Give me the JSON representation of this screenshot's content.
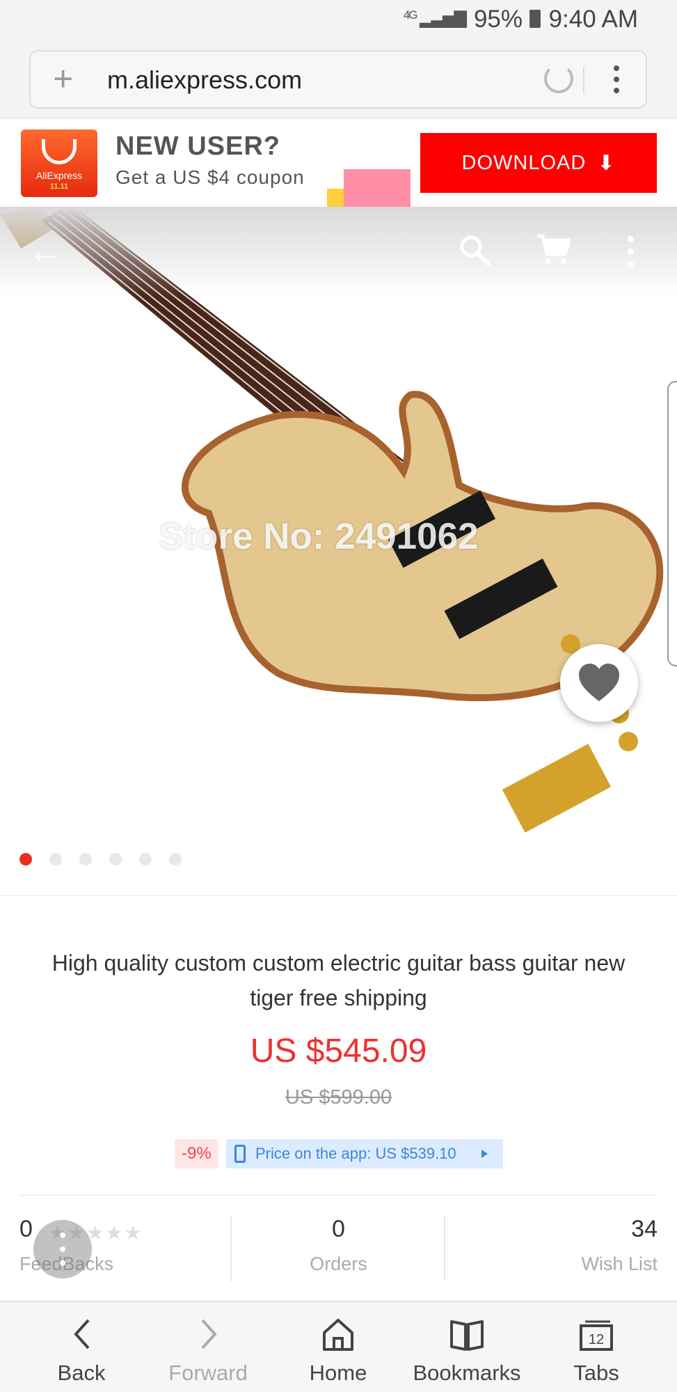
{
  "status_bar": {
    "network": "4G",
    "battery": "95%",
    "time": "9:40 AM"
  },
  "browser": {
    "url": "m.aliexpress.com"
  },
  "promo": {
    "logo_text": "AliExpress",
    "logo_sub": "11.11",
    "headline": "NEW USER?",
    "subline": "Get a US $4 coupon",
    "download_label": "DOWNLOAD"
  },
  "hero": {
    "watermark": "Store No: 2491062",
    "slide_count": 6,
    "active_slide": 1
  },
  "product": {
    "title": "High quality custom custom electric guitar bass guitar new tiger free shipping",
    "price": "US $545.09",
    "original_price": "US $599.00",
    "discount": "-9%",
    "app_price": "Price on the app: US $539.10"
  },
  "stats": {
    "feedbacks_count": "0",
    "feedbacks_label": "FeedBacks",
    "orders_count": "0",
    "orders_label": "Orders",
    "wishlist_count": "34",
    "wishlist_label": "Wish List"
  },
  "bottom_nav": {
    "back": "Back",
    "forward": "Forward",
    "home": "Home",
    "bookmarks": "Bookmarks",
    "tabs": "Tabs",
    "tabs_count": "12"
  }
}
